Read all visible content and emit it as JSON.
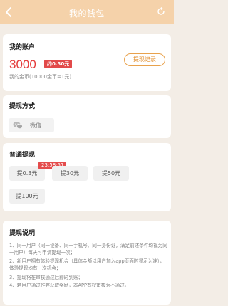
{
  "header": {
    "title": "我的钱包"
  },
  "account": {
    "title": "我的账户",
    "coins": "3000",
    "approx": "约0.30元",
    "rate": "我的金币(10000金币=1元)",
    "record_label": "提现记录"
  },
  "method": {
    "title": "提现方式",
    "label": "微信"
  },
  "withdraw": {
    "title": "普通提现",
    "timer": "23:58:51",
    "options": [
      "提0.3元",
      "提30元",
      "提50元",
      "提100元"
    ]
  },
  "notes": {
    "title": "提现说明",
    "items": [
      "1、同一用户（同一设备、同一手机号、同一身份证，满足前述条件均视为同一用户）每天可申请提现一次；",
      "2、新用户拥有体验提现机会（具体金额以用户加入app页面时显示为准），体验提现均有一次机会；",
      "3、提现将在审核通过后即时到账；",
      "4、若用户通过作弊获取奖励，本APP有权审核为不通过。"
    ]
  },
  "colors": {
    "header_bg": "#f5d2aa",
    "amount_red": "#e43a3a",
    "record_orange": "#e08a25",
    "page_bg": "#f3ede6"
  },
  "icons": {
    "back": "chevron-left-icon",
    "refresh": "refresh-icon",
    "wechat": "wechat-icon"
  }
}
